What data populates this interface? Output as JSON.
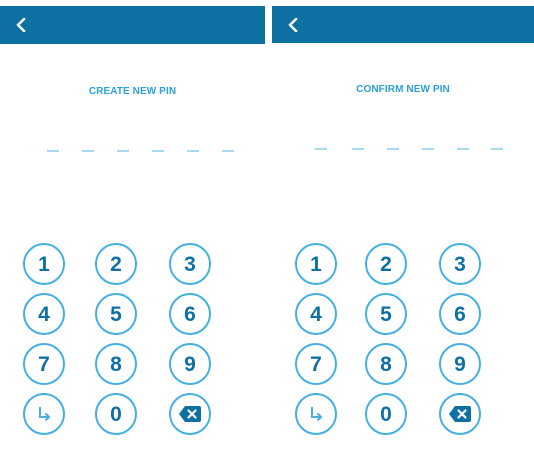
{
  "screens": {
    "create": {
      "title": "CREATE NEW PIN",
      "pin_length": 6,
      "pin_entered": 0
    },
    "confirm": {
      "title": "CONFIRM NEW PIN",
      "pin_length": 6,
      "pin_entered": 0
    }
  },
  "keypad": {
    "keys": [
      "1",
      "2",
      "3",
      "4",
      "5",
      "6",
      "7",
      "8",
      "9",
      "",
      "0",
      ""
    ],
    "special_keys": {
      "enter": "enter-arrow-icon",
      "backspace": "backspace-icon"
    }
  },
  "colors": {
    "header": "#0f70a4",
    "title_text": "#2ca1d6",
    "key_border": "#45afe2",
    "key_digit": "#0f70a4",
    "dash": "#a7d9f0"
  }
}
